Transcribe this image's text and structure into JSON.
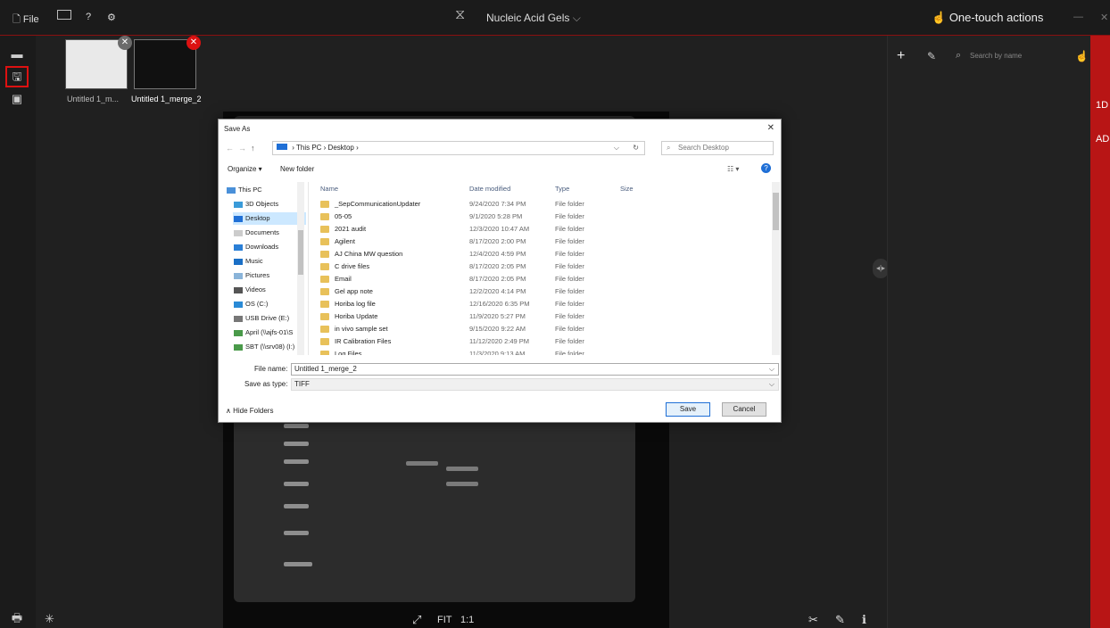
{
  "topbar": {
    "file_label": "File",
    "help_label": "?",
    "app_title": "Nucleic Acid Gels",
    "one_touch_label": "One-touch actions"
  },
  "thumbnails": [
    {
      "label": "Untitled 1_m..."
    },
    {
      "label": "Untitled 1_merge_2"
    }
  ],
  "right_panel": {
    "search_placeholder": "Search by name",
    "strip_labels": [
      "1D",
      "AD"
    ]
  },
  "dialog": {
    "title": "Save As",
    "breadcrumb": "› This PC › Desktop ›",
    "search_placeholder": "Search Desktop",
    "organize_label": "Organize ▾",
    "new_folder_label": "New folder",
    "nav_items": [
      "This PC",
      "3D Objects",
      "Desktop",
      "Documents",
      "Downloads",
      "Music",
      "Pictures",
      "Videos",
      "OS (C:)",
      "USB Drive (E:)",
      "April (\\\\ajfs-01\\S",
      "SBT (\\\\srv08) (I:)"
    ],
    "columns": [
      "Name",
      "Date modified",
      "Type",
      "Size"
    ],
    "files": [
      {
        "name": "_SepCommunicationUpdater",
        "date": "9/24/2020 7:34 PM",
        "type": "File folder"
      },
      {
        "name": "05-05",
        "date": "9/1/2020 5:28 PM",
        "type": "File folder"
      },
      {
        "name": "2021 audit",
        "date": "12/3/2020 10:47 AM",
        "type": "File folder"
      },
      {
        "name": "Agilent",
        "date": "8/17/2020 2:00 PM",
        "type": "File folder"
      },
      {
        "name": "AJ China MW question",
        "date": "12/4/2020 4:59 PM",
        "type": "File folder"
      },
      {
        "name": "C drive files",
        "date": "8/17/2020 2:05 PM",
        "type": "File folder"
      },
      {
        "name": "Email",
        "date": "8/17/2020 2:05 PM",
        "type": "File folder"
      },
      {
        "name": "Gel app note",
        "date": "12/2/2020 4:14 PM",
        "type": "File folder"
      },
      {
        "name": "Horiba log file",
        "date": "12/16/2020 6:35 PM",
        "type": "File folder"
      },
      {
        "name": "Horiba Update",
        "date": "11/9/2020 5:27 PM",
        "type": "File folder"
      },
      {
        "name": "in vivo sample set",
        "date": "9/15/2020 9:22 AM",
        "type": "File folder"
      },
      {
        "name": "IR Calibration Files",
        "date": "11/12/2020 2:49 PM",
        "type": "File folder"
      },
      {
        "name": "Log Files",
        "date": "11/3/2020 9:13 AM",
        "type": "File folder"
      }
    ],
    "file_name_label": "File name:",
    "file_name_value": "Untitled 1_merge_2",
    "save_type_label": "Save as type:",
    "save_type_value": "TIFF",
    "hide_folders_label": "Hide Folders",
    "save_label": "Save",
    "cancel_label": "Cancel"
  },
  "bottom": {
    "fit_label": "FIT",
    "one_to_one_label": "1:1"
  },
  "colors": {
    "accent": "#b81515",
    "topbar": "#1b1b1b",
    "canvas": "#0a0a0a"
  }
}
